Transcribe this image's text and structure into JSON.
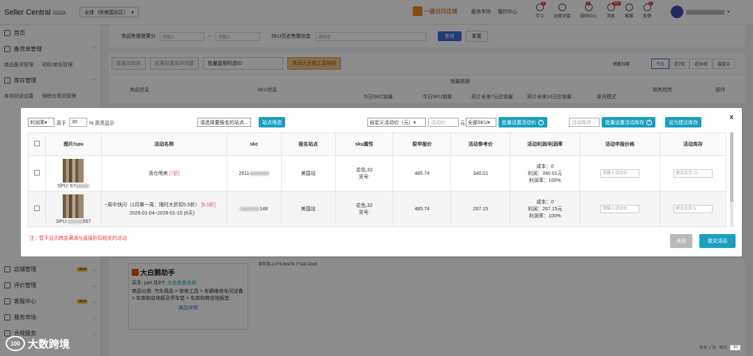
{
  "topbar": {
    "brand": "Seller Central",
    "beta": "Beta",
    "region": "全球（除美国站区）",
    "visit_store": "一键访问店铺",
    "links": [
      "服务市场",
      "履约中心"
    ],
    "icons": [
      {
        "icon": "study-icon",
        "label": "学习",
        "badge": "4"
      },
      {
        "icon": "ops-icon",
        "label": "运营对接",
        "badge": ""
      },
      {
        "icon": "rules-icon",
        "label": "规则中心",
        "badge": "1"
      },
      {
        "icon": "message-icon",
        "label": "消息",
        "badge": "99+"
      },
      {
        "icon": "service-icon",
        "label": "客服",
        "badge": ""
      },
      {
        "icon": "feedback-icon",
        "label": "反馈",
        "badge": "1"
      }
    ]
  },
  "sidebar": {
    "items": [
      {
        "label": "首页",
        "icon": "home-icon"
      },
      {
        "label": "备货单管理",
        "icon": "order-icon"
      },
      {
        "label": "库存管理",
        "icon": "inventory-icon"
      },
      {
        "label": "店铺管理",
        "icon": "store-icon",
        "new": "NEW"
      },
      {
        "label": "评价管理",
        "icon": "review-icon"
      },
      {
        "label": "客服中心",
        "icon": "support-icon",
        "new": "NEW"
      },
      {
        "label": "服务市场",
        "icon": "market-icon"
      },
      {
        "label": "合规服务",
        "icon": "compliance-icon"
      }
    ],
    "sub_rows": [
      [
        "商品备货管理",
        "司机/地址管理"
      ],
      [
        "库存回送设置",
        "保税仓退货管理"
      ]
    ]
  },
  "main": {
    "filter": {
      "label1": "商品售罄健康分",
      "ph1": "请输入",
      "ph2": "请输入",
      "label2": "SKU历史售罄状态",
      "ph3": "请选择",
      "query": "查询",
      "reset": "重置"
    },
    "toolbar": {
      "b1": "批量加库存",
      "b2": "批量配置库存预警",
      "b3": "批量复制所选ID",
      "b4": "关闭大白鹅工具按钮",
      "date_label": "销量日期",
      "tabs": [
        "今日",
        "近7日",
        "近30日",
        "自定义"
      ]
    },
    "thead": [
      "商品信息",
      "SKU信息",
      "销量数据",
      "今日SKC销量",
      "今日SKU销量",
      "预计未来7日总销量",
      "预计未来14日总销量",
      "发货模式",
      "销售趋势",
      "操作"
    ]
  },
  "modal": {
    "filter_field": "利润率",
    "high_label": "高于",
    "high_value": "30",
    "high_suffix": "% 高亮显示",
    "site_select": "请选择要报名的站点...",
    "site_filter": "站点筛选",
    "price_mode": "自定义活动价（元）",
    "price_ph": "活动价",
    "price_unit": "元",
    "sku_scope": "全部SKU",
    "batch_price": "批量设置活动价",
    "stock_ph": "活动库存",
    "batch_stock": "批量设置活动库存",
    "suggest_stock": "设为建议库存",
    "columns": [
      "图片/spu",
      "活动名称",
      "skc",
      "报名站点",
      "sku属性",
      "原申报价",
      "活动参考价",
      "活动利润/利润率",
      "活动申报价格",
      "活动库存"
    ],
    "rows": [
      {
        "spu": "SPU: 67",
        "activity": "清仓甩卖",
        "discount": "[7折]",
        "activity_time": "",
        "skc": "2611",
        "site": "美国站",
        "attr": "花色,32",
        "sku_no": "货号:",
        "orig_price": "485.74",
        "ref_price": "340.01",
        "cost": "成本：0",
        "profit": "利润：340.01元",
        "margin": "利润率：100%",
        "price_ph": "请输入活动价",
        "stock_ph": "建议库存:10"
      },
      {
        "spu": "SPU:",
        "spu_tail": "557",
        "activity": "~周中快闪（1月第一周：限时大折扣5.5折）",
        "discount": "[5.5折]",
        "activity_time": "2026-01-04~2026-01-10 (6天)",
        "skc": "148",
        "site": "美国站",
        "attr": "花色,32",
        "sku_no": "货号:",
        "orig_price": "485.74",
        "ref_price": "267.15",
        "cost": "成本：0",
        "profit": "利润：267.15元",
        "margin": "利润率：100%",
        "price_ph": "请输入活动价",
        "stock_ph": "建议库存:5"
      }
    ],
    "note": "注：暂不显示跨店满减与直接折扣相关的活动",
    "close": "关闭",
    "submit": "提交活动",
    "close_x": "x"
  },
  "product": {
    "title": "大白鹅助手",
    "seller": "买手: juel",
    "count": "共3个",
    "view_all": "点击查看全部",
    "category": "商品分类: 汽车用品 > 修修工具 > 车辆维修车间设备 > 车库和店地板及停车垫 > 车库和商店地板垫",
    "detail": "商品详情",
    "spec": "深灰色-2.0*3.0m/78.7*118.1inch"
  },
  "watermark": "大数跨境",
  "pager": {
    "total": "共有 2 条",
    "page_label": "每页",
    "size": "30"
  }
}
